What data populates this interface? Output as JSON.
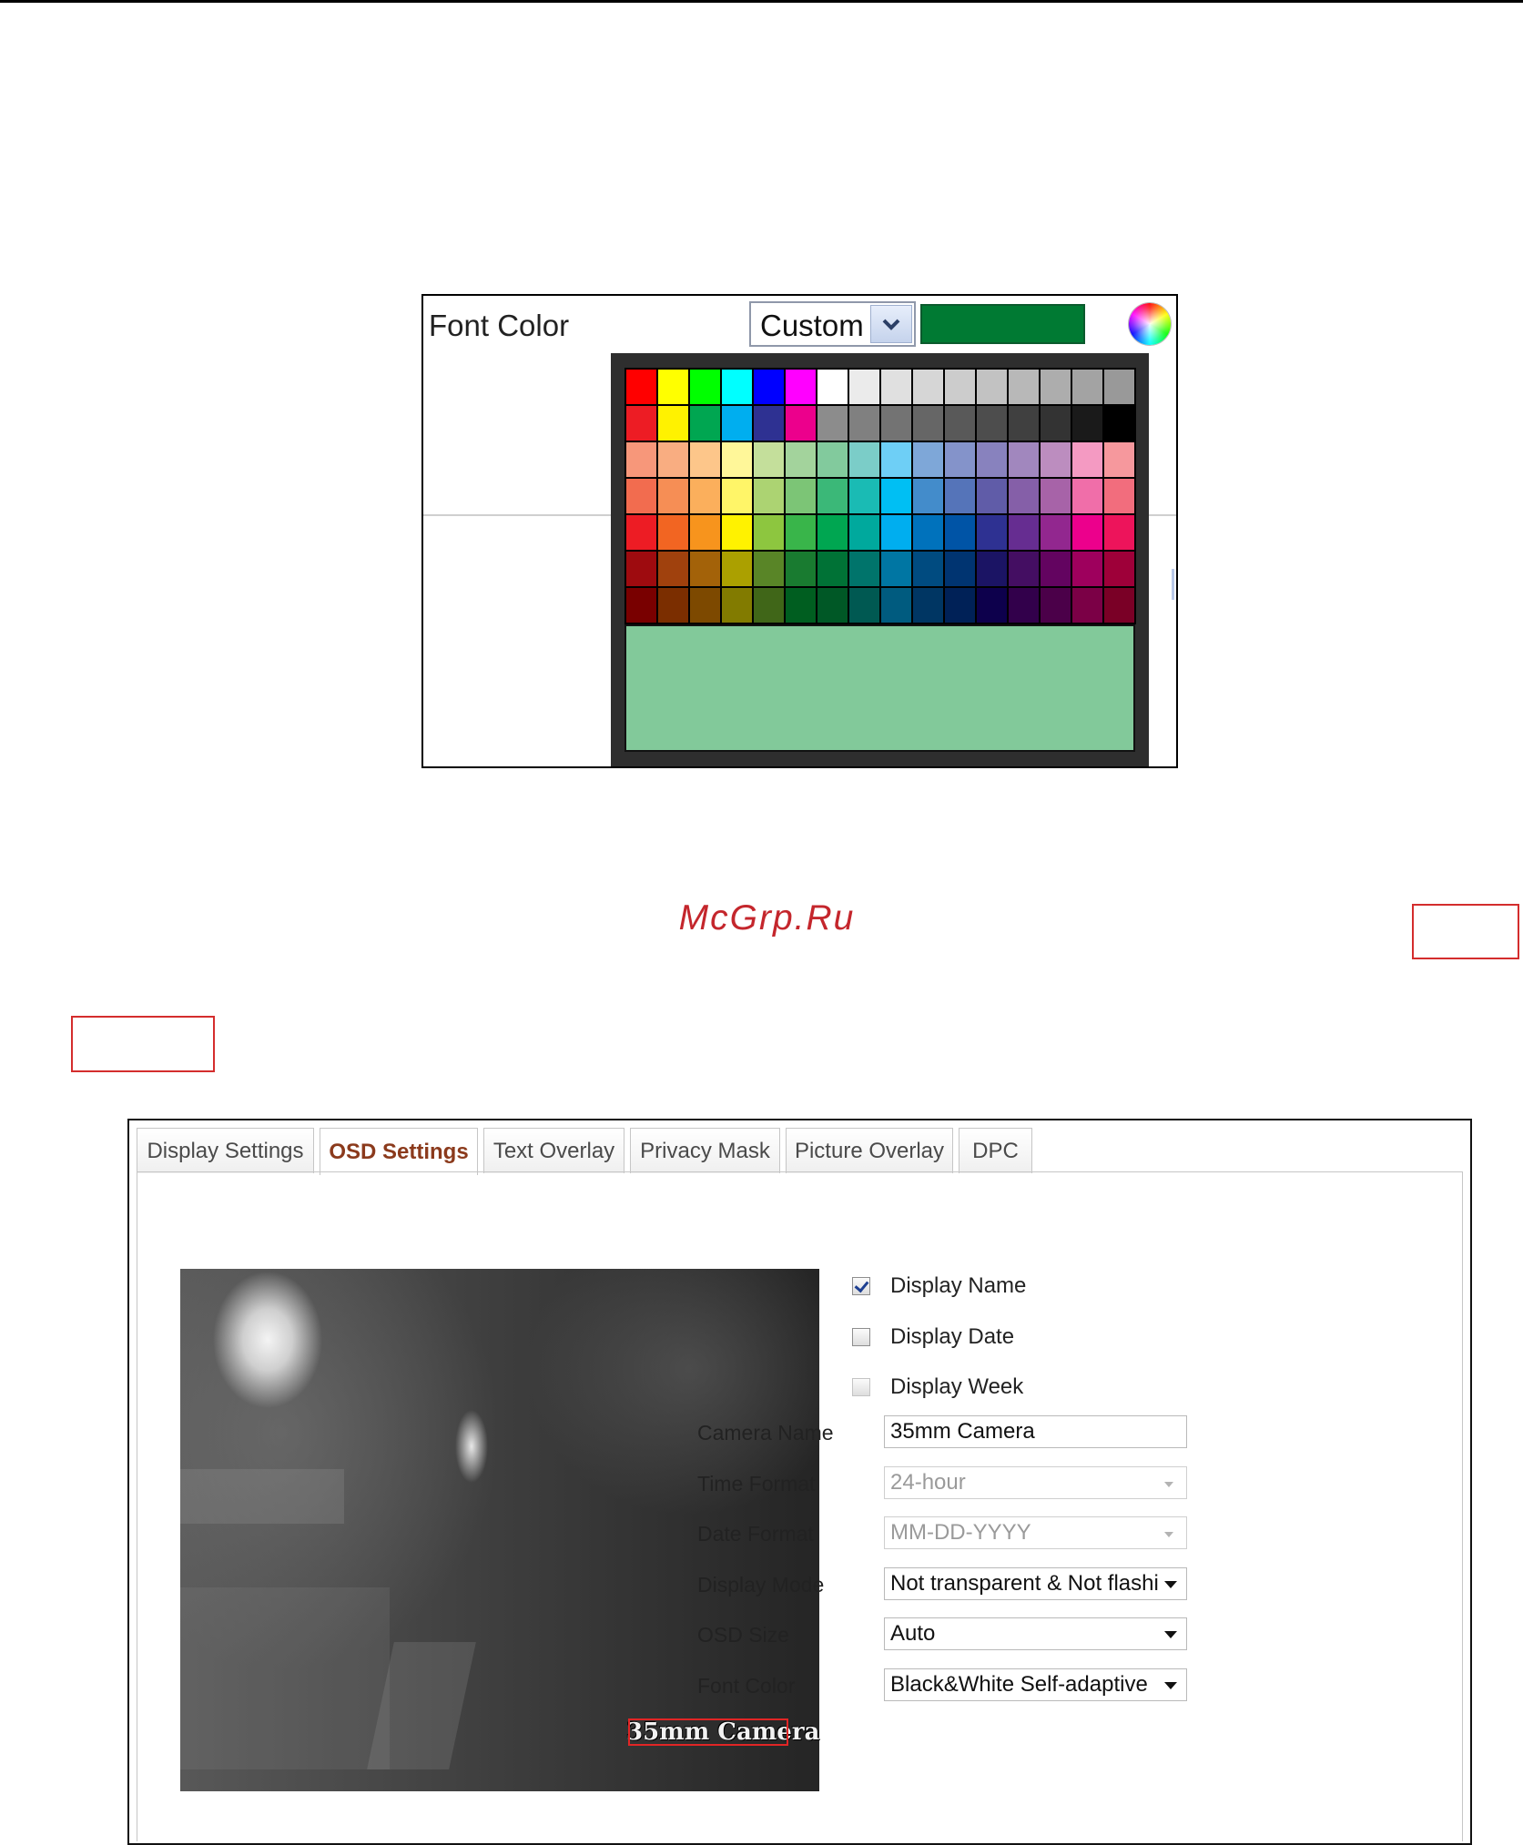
{
  "font_color_picker": {
    "label": "Font Color",
    "mode_selected": "Custom",
    "current_color": "#007a33",
    "preview_color": "#82c99a",
    "palette_rows": [
      [
        "#ff0000",
        "#ffff00",
        "#00ff00",
        "#00ffff",
        "#0000ff",
        "#ff00ff",
        "#ffffff",
        "#ebebeb",
        "#e0e0e0",
        "#d6d6d6",
        "#cccccc",
        "#c2c2c2",
        "#b8b8b8",
        "#adadad",
        "#a3a3a3",
        "#999999"
      ],
      [
        "#ed1c24",
        "#fff200",
        "#00a651",
        "#00aeef",
        "#2e3192",
        "#ec008c",
        "#8c8c8c",
        "#808080",
        "#737373",
        "#666666",
        "#595959",
        "#4d4d4d",
        "#404040",
        "#333333",
        "#1a1a1a",
        "#000000"
      ],
      [
        "#f7977a",
        "#f9ad81",
        "#fdc68a",
        "#fff799",
        "#c4df9b",
        "#a3d39c",
        "#82ca9d",
        "#7bcdc8",
        "#6ecff6",
        "#7ea7d8",
        "#8493ca",
        "#8882be",
        "#a187be",
        "#bc8dbf",
        "#f49ac2",
        "#f6989d"
      ],
      [
        "#f26c4f",
        "#f68e55",
        "#fbaf5c",
        "#fff568",
        "#acd372",
        "#7cc576",
        "#3bb878",
        "#1abbb4",
        "#00bff3",
        "#438ccb",
        "#5574b9",
        "#605ca8",
        "#855fa8",
        "#a763a8",
        "#f06ea9",
        "#f26d7d"
      ],
      [
        "#ed1c24",
        "#f26522",
        "#f7941d",
        "#fff200",
        "#8dc63f",
        "#39b54a",
        "#00a651",
        "#00a99d",
        "#00aeef",
        "#0072bc",
        "#0054a6",
        "#2e3192",
        "#662d91",
        "#92278f",
        "#ec008c",
        "#ed145b"
      ],
      [
        "#9e0b0f",
        "#a0410d",
        "#a36209",
        "#aba000",
        "#598527",
        "#197b30",
        "#007236",
        "#00746b",
        "#0076a3",
        "#004b80",
        "#003471",
        "#1b1464",
        "#440e62",
        "#630460",
        "#9e005d",
        "#9e0039"
      ],
      [
        "#790000",
        "#7b2e00",
        "#7d4900",
        "#827b00",
        "#406618",
        "#005e20",
        "#005826",
        "#005952",
        "#005b7f",
        "#003663",
        "#002157",
        "#0d004c",
        "#32004b",
        "#4b0049",
        "#7b0046",
        "#7a0026"
      ]
    ]
  },
  "watermark": "McGrp.Ru",
  "tabs": [
    {
      "label": "Display Settings"
    },
    {
      "label": "OSD Settings"
    },
    {
      "label": "Text Overlay"
    },
    {
      "label": "Privacy Mask"
    },
    {
      "label": "Picture Overlay"
    },
    {
      "label": "DPC"
    }
  ],
  "active_tab": "OSD Settings",
  "video": {
    "osd_text": "35mm Camera"
  },
  "checkboxes": [
    {
      "label": "Display Name",
      "checked": true
    },
    {
      "label": "Display Date",
      "checked": false
    },
    {
      "label": "Display Week",
      "checked": false
    }
  ],
  "form": {
    "camera_name": {
      "label": "Camera Name",
      "value": "35mm Camera"
    },
    "time_format": {
      "label": "Time Format",
      "value": "24-hour",
      "disabled": true
    },
    "date_format": {
      "label": "Date Format",
      "value": "MM-DD-YYYY",
      "disabled": true
    },
    "display_mode": {
      "label": "Display Mode",
      "value": "Not transparent & Not flashing"
    },
    "osd_size": {
      "label": "OSD Size",
      "value": "Auto"
    },
    "font_color": {
      "label": "Font Color",
      "value": "Black&White Self-adaptive"
    }
  }
}
